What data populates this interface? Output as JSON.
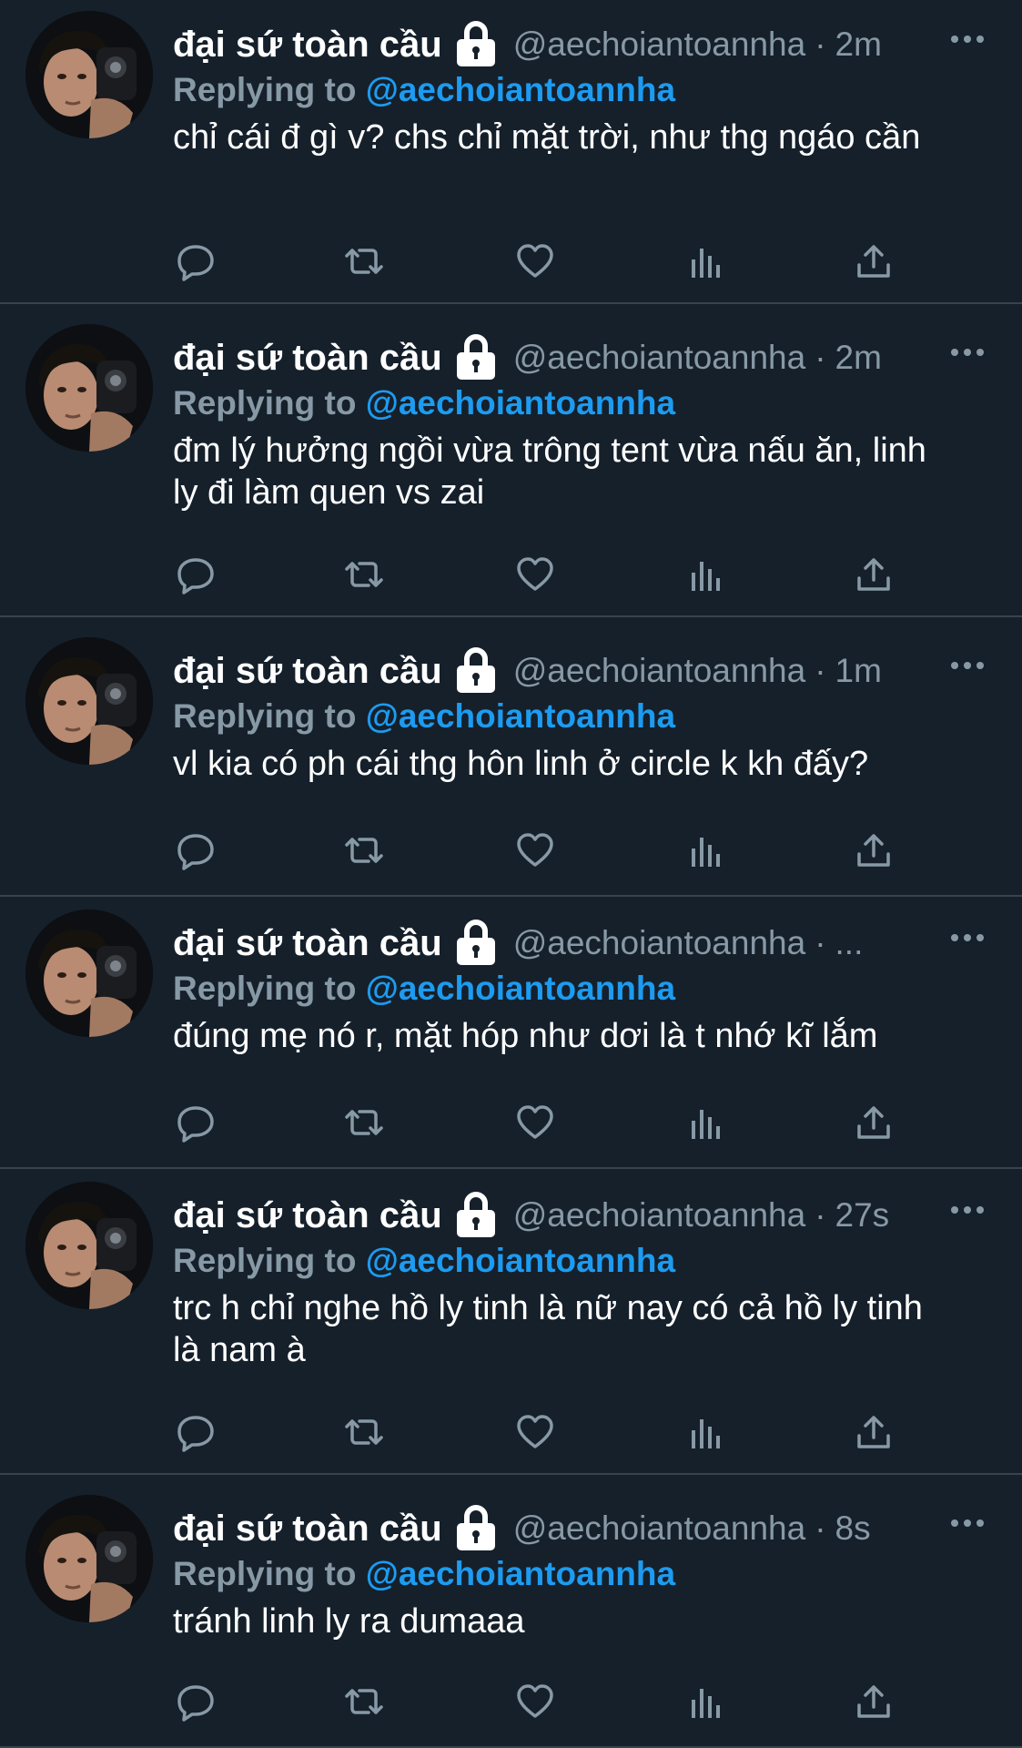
{
  "timeline": {
    "tweets": [
      {
        "author_name": "đại sứ toàn cầu",
        "handle": "@aechoiantoannha",
        "separator": "·",
        "time": "2m",
        "reply_prefix": "Replying to",
        "reply_handle": "@aechoiantoannha",
        "text": "chỉ cái đ gì v? chs chỉ mặt trời, như thg ngáo cần"
      },
      {
        "author_name": "đại sứ toàn cầu",
        "handle": "@aechoiantoannha",
        "separator": "·",
        "time": "2m",
        "reply_prefix": "Replying to",
        "reply_handle": "@aechoiantoannha",
        "text": "đm lý hưởng ngồi vừa trông tent vừa nấu ăn, linh ly đi làm quen vs zai"
      },
      {
        "author_name": "đại sứ toàn cầu",
        "handle": "@aechoiantoannha",
        "separator": "·",
        "time": "1m",
        "reply_prefix": "Replying to",
        "reply_handle": "@aechoiantoannha",
        "text": "vl kia có ph cái thg hôn linh ở circle k kh đấy?"
      },
      {
        "author_name": "đại sứ toàn cầu",
        "handle": "@aechoiantoannha",
        "separator": "·",
        "time": "...",
        "reply_prefix": "Replying to",
        "reply_handle": "@aechoiantoannha",
        "text": "đúng mẹ nó r, mặt hóp như dơi là t nhớ kĩ lắm"
      },
      {
        "author_name": "đại sứ toàn cầu",
        "handle": "@aechoiantoannha",
        "separator": "·",
        "time": "27s",
        "reply_prefix": "Replying to",
        "reply_handle": "@aechoiantoannha",
        "text": "trc h chỉ nghe hồ ly tinh là nữ nay có cả hồ ly tinh là nam à"
      },
      {
        "author_name": "đại sứ toàn cầu",
        "handle": "@aechoiantoannha",
        "separator": "·",
        "time": "8s",
        "reply_prefix": "Replying to",
        "reply_handle": "@aechoiantoannha",
        "text": "tránh linh ly ra dumaaa"
      }
    ]
  },
  "icons": {
    "avatar": "avatar-photo",
    "lock": "lock-icon",
    "more": "more-icon",
    "reply": "reply-icon",
    "retweet": "retweet-icon",
    "like": "heart-icon",
    "stats": "stats-icon",
    "share": "share-icon"
  },
  "colors": {
    "background": "#15202b",
    "divider": "#38444d",
    "secondary_text": "#8899a6",
    "link": "#1d9bf0",
    "primary_text": "#ffffff"
  }
}
